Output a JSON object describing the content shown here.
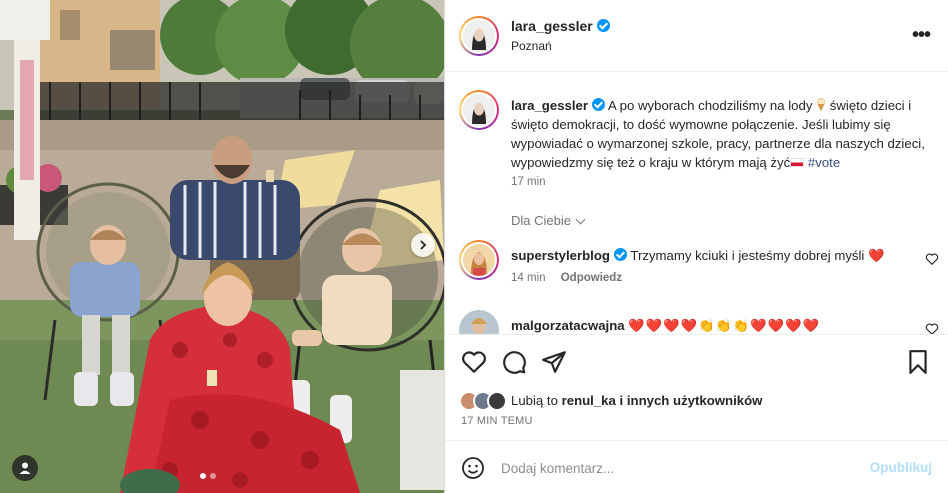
{
  "post": {
    "username": "lara_gessler",
    "location": "Poznań",
    "more_label": "•••"
  },
  "caption": {
    "username": "lara_gessler",
    "text_before_icecream": "A po wyborach chodziliśmy na lody",
    "text_after_icecream": "święto dzieci i święto demokracji, to dość wymowne połączenie. Jeśli lubimy się wypowiadać o wymarzonej szkole, pracy, partnerze dla naszych dzieci, wypowiedzmy się też o kraju w którym mają żyć",
    "hashtag": "#vote",
    "time": "17 min"
  },
  "for_you": {
    "label": "Dla Ciebie"
  },
  "comments": [
    {
      "username": "superstylerblog",
      "text": "Trzymamy kciuki i jesteśmy dobrej myśli",
      "emoji": "❤️",
      "time": "14 min",
      "reply_label": "Odpowiedz",
      "verified": true
    },
    {
      "username": "malgorzatacwajna",
      "text": "❤️❤️❤️❤️👏👏👏❤️❤️❤️❤️",
      "verified": false
    }
  ],
  "likes": {
    "prefix": "Lubią to",
    "user": "renul_ka",
    "suffix": "i innych użytkowników"
  },
  "post_time": "17 MIN TEMU",
  "add_comment": {
    "placeholder": "Dodaj komentarz...",
    "publish_label": "Opublikuj"
  },
  "colors": {
    "accent": "#0095f6",
    "like_red": "#e0245e",
    "muted": "#737373"
  }
}
